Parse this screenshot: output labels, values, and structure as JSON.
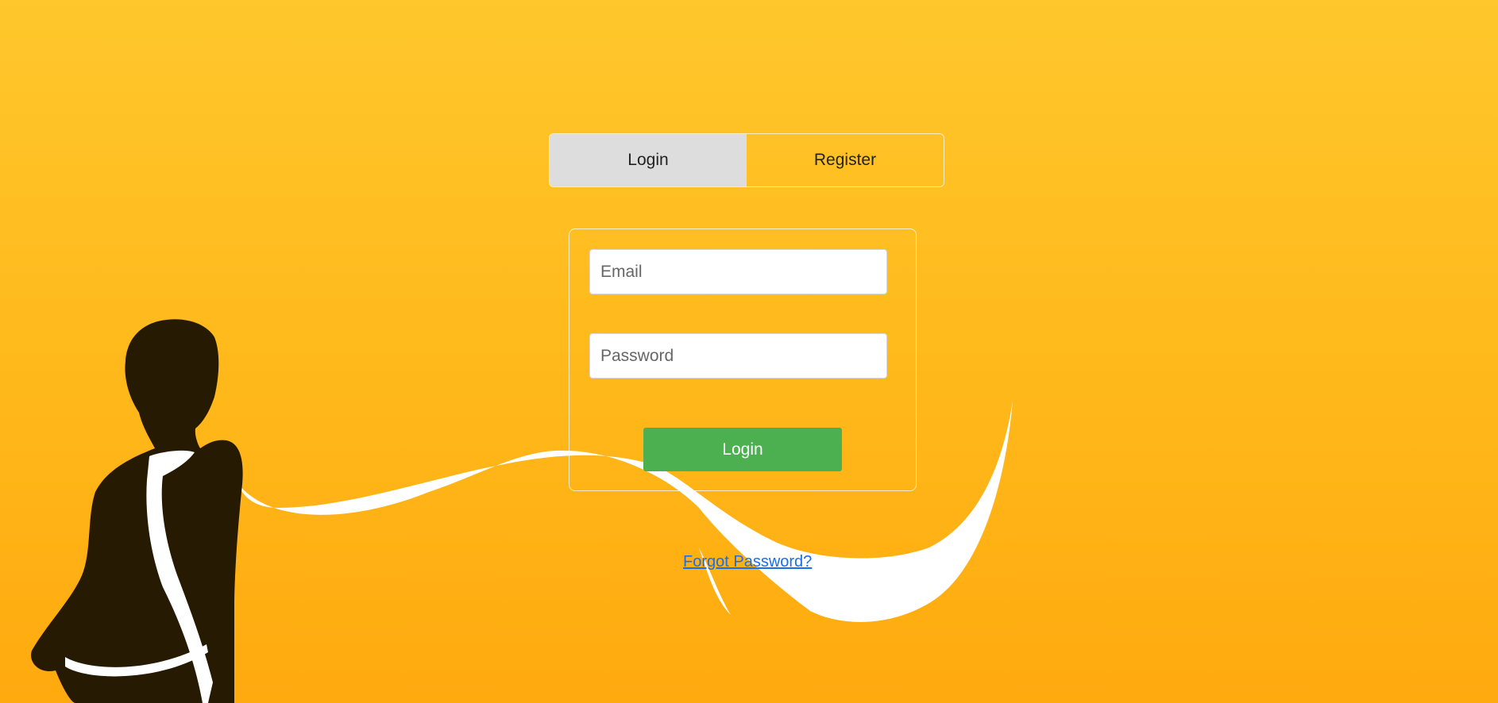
{
  "tabs": [
    {
      "label": "Login",
      "active": true
    },
    {
      "label": "Register",
      "active": false
    }
  ],
  "form": {
    "email_placeholder": "Email",
    "password_placeholder": "Password",
    "submit_label": "Login"
  },
  "forgot_password": "Forgot Password?",
  "colors": {
    "background_top": "#FFC72C",
    "background_bottom": "#FFAA0F",
    "active_tab": "#DDDDDD",
    "submit_button": "#4CAF50",
    "link": "#1A6FE8",
    "silhouette": "#261A02"
  }
}
